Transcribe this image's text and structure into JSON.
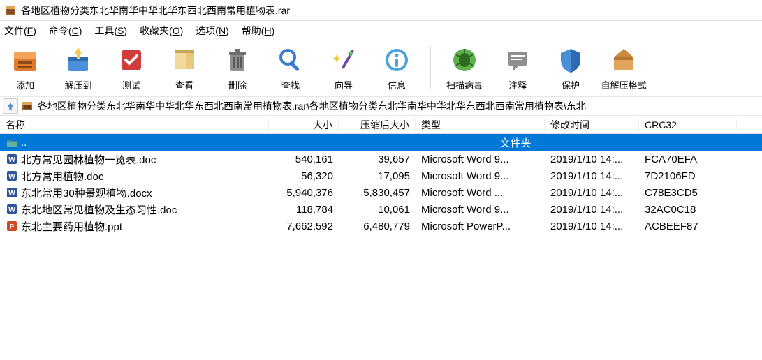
{
  "window": {
    "title": "各地区植物分类东北华南华中华北华东西北西南常用植物表.rar"
  },
  "menu": {
    "items": [
      {
        "label": "文件(F)",
        "hotkey": "F"
      },
      {
        "label": "命令(C)",
        "hotkey": "C"
      },
      {
        "label": "工具(S)",
        "hotkey": "S"
      },
      {
        "label": "收藏夹(O)",
        "hotkey": "O"
      },
      {
        "label": "选项(N)",
        "hotkey": "N"
      },
      {
        "label": "帮助(H)",
        "hotkey": "H"
      }
    ]
  },
  "toolbar": {
    "buttons": [
      {
        "id": "add",
        "label": "添加"
      },
      {
        "id": "extract",
        "label": "解压到"
      },
      {
        "id": "test",
        "label": "测试"
      },
      {
        "id": "view",
        "label": "查看"
      },
      {
        "id": "delete",
        "label": "删除"
      },
      {
        "id": "find",
        "label": "查找"
      },
      {
        "id": "wizard",
        "label": "向导"
      },
      {
        "id": "info",
        "label": "信息"
      },
      {
        "id": "scan",
        "label": "扫描病毒"
      },
      {
        "id": "comment",
        "label": "注释"
      },
      {
        "id": "protect",
        "label": "保护"
      },
      {
        "id": "sfx",
        "label": "自解压格式"
      }
    ]
  },
  "path": {
    "text": "各地区植物分类东北华南华中华北华东西北西南常用植物表.rar\\各地区植物分类东北华南华中华北华东西北西南常用植物表\\东北"
  },
  "columns": {
    "name": "名称",
    "size": "大小",
    "packed": "压缩后大小",
    "type": "类型",
    "modified": "修改时间",
    "crc": "CRC32"
  },
  "parent_row": {
    "name": "..",
    "type": "文件夹"
  },
  "files": [
    {
      "icon": "word",
      "name": "北方常见园林植物一览表.doc",
      "size": "540,161",
      "packed": "39,657",
      "type": "Microsoft Word 9...",
      "modified": "2019/1/10 14:...",
      "crc": "FCA70EFA"
    },
    {
      "icon": "word",
      "name": "北方常用植物.doc",
      "size": "56,320",
      "packed": "17,095",
      "type": "Microsoft Word 9...",
      "modified": "2019/1/10 14:...",
      "crc": "7D2106FD"
    },
    {
      "icon": "word",
      "name": "东北常用30种景观植物.docx",
      "size": "5,940,376",
      "packed": "5,830,457",
      "type": "Microsoft Word ...",
      "modified": "2019/1/10 14:...",
      "crc": "C78E3CD5"
    },
    {
      "icon": "word",
      "name": "东北地区常见植物及生态习性.doc",
      "size": "118,784",
      "packed": "10,061",
      "type": "Microsoft Word 9...",
      "modified": "2019/1/10 14:...",
      "crc": "32AC0C18"
    },
    {
      "icon": "ppt",
      "name": "东北主要药用植物.ppt",
      "size": "7,662,592",
      "packed": "6,480,779",
      "type": "Microsoft PowerP...",
      "modified": "2019/1/10 14:...",
      "crc": "ACBEEF87"
    }
  ]
}
